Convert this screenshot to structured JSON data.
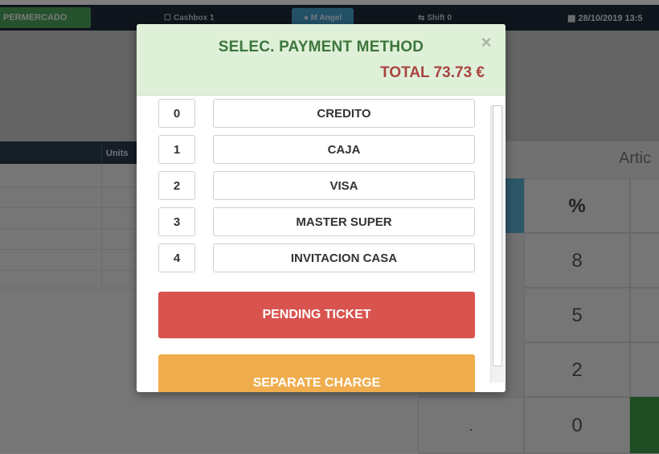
{
  "topbar": {
    "store_label": "PERMERCADO",
    "cashbox_label": "Cashbox 1",
    "user_label": "M Angel",
    "shift_label": "Shift 0",
    "datetime_label": "28/10/2019 13:5"
  },
  "table": {
    "units_header": "Units"
  },
  "keypad": {
    "articles_label": "Artic",
    "keys": [
      "%",
      "8",
      "5",
      "2",
      ".",
      "0"
    ]
  },
  "modal": {
    "title": "SELEC. PAYMENT METHOD",
    "close_symbol": "×",
    "total": "TOTAL 73.73 €",
    "payment_methods": [
      {
        "num": "0",
        "label": "CREDITO"
      },
      {
        "num": "1",
        "label": "CAJA"
      },
      {
        "num": "2",
        "label": "VISA"
      },
      {
        "num": "3",
        "label": "MASTER SUPER"
      },
      {
        "num": "4",
        "label": "INVITACION CASA"
      }
    ],
    "pending_label": "PENDING TICKET",
    "separate_label": "SEPARATE CHARGE"
  },
  "colors": {
    "header_bg": "#dff0d8",
    "title_green": "#3c763d",
    "total_red": "#a94442",
    "pending_red": "#d9534f",
    "separate_orange": "#f0ad4e"
  }
}
